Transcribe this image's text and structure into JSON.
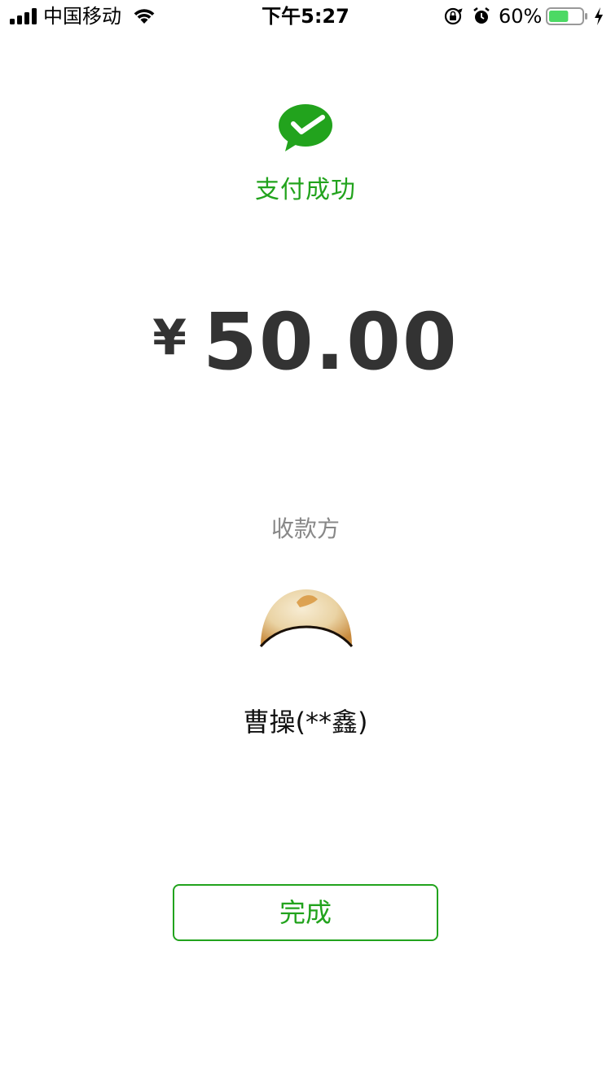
{
  "status_bar": {
    "carrier": "中国移动",
    "time": "下午5:27",
    "battery_percent": "60%",
    "battery_level": 0.6,
    "battery_color": "#4cd964",
    "icons": [
      "signal-icon",
      "wifi-icon",
      "orientation-lock-icon",
      "alarm-icon",
      "battery-icon",
      "charging-icon"
    ]
  },
  "success": {
    "title": "支付成功",
    "icon": "wechat-pay-icon",
    "color": "#22a31d"
  },
  "payment": {
    "currency_symbol": "¥",
    "amount": "50.00"
  },
  "payee": {
    "label": "收款方",
    "name": "曹操(**鑫)"
  },
  "actions": {
    "done_label": "完成"
  }
}
